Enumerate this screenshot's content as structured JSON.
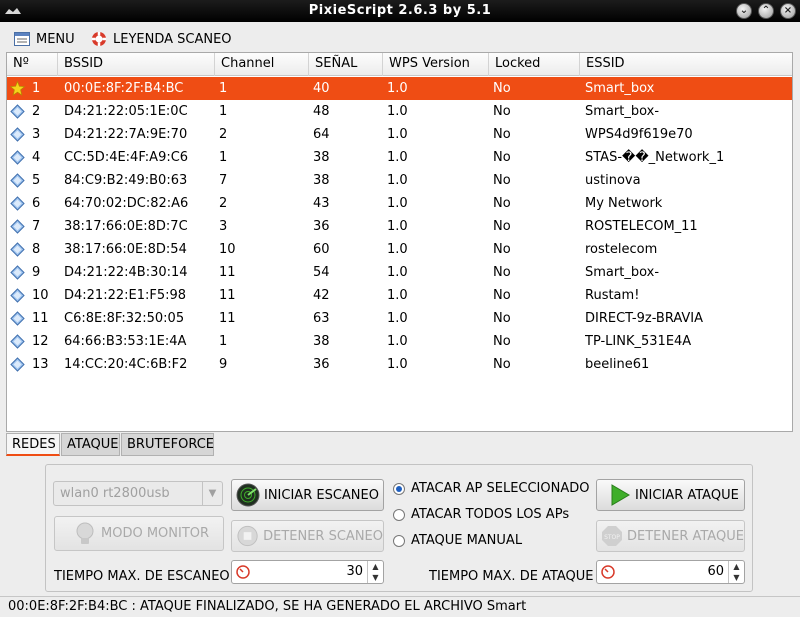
{
  "window": {
    "title": "PixieScript 2.6.3 by 5.1"
  },
  "menubar": {
    "menu_label": "MENU",
    "legend_label": "LEYENDA SCANEO"
  },
  "table": {
    "headers": [
      "Nº",
      "BSSID",
      "Channel",
      "SEÑAL",
      "WPS Version",
      "Locked",
      "ESSID"
    ],
    "rows": [
      {
        "n": "1",
        "bssid": "00:0E:8F:2F:B4:BC",
        "channel": "1",
        "signal": "40",
        "wps": "1.0",
        "locked": "No",
        "essid": "Smart_box",
        "icon": "star-icon",
        "selected": true
      },
      {
        "n": "2",
        "bssid": "D4:21:22:05:1E:0C",
        "channel": "1",
        "signal": "48",
        "wps": "1.0",
        "locked": "No",
        "essid": "Smart_box-",
        "icon": "diamond-icon"
      },
      {
        "n": "3",
        "bssid": "D4:21:22:7A:9E:70",
        "channel": "2",
        "signal": "64",
        "wps": "1.0",
        "locked": "No",
        "essid": "WPS4d9f619e70",
        "icon": "diamond-icon"
      },
      {
        "n": "4",
        "bssid": "CC:5D:4E:4F:A9:C6",
        "channel": "1",
        "signal": "38",
        "wps": "1.0",
        "locked": "No",
        "essid": "STAS-��_Network_1",
        "icon": "diamond-icon"
      },
      {
        "n": "5",
        "bssid": "84:C9:B2:49:B0:63",
        "channel": "7",
        "signal": "38",
        "wps": "1.0",
        "locked": "No",
        "essid": "ustinova",
        "icon": "diamond-icon"
      },
      {
        "n": "6",
        "bssid": "64:70:02:DC:82:A6",
        "channel": "2",
        "signal": "43",
        "wps": "1.0",
        "locked": "No",
        "essid": "My Network",
        "icon": "diamond-icon"
      },
      {
        "n": "7",
        "bssid": "38:17:66:0E:8D:7C",
        "channel": "3",
        "signal": "36",
        "wps": "1.0",
        "locked": "No",
        "essid": "ROSTELECOM_11",
        "icon": "diamond-icon"
      },
      {
        "n": "8",
        "bssid": "38:17:66:0E:8D:54",
        "channel": "10",
        "signal": "60",
        "wps": "1.0",
        "locked": "No",
        "essid": "rostelecom",
        "icon": "diamond-icon"
      },
      {
        "n": "9",
        "bssid": "D4:21:22:4B:30:14",
        "channel": "11",
        "signal": "54",
        "wps": "1.0",
        "locked": "No",
        "essid": "Smart_box-",
        "icon": "diamond-icon"
      },
      {
        "n": "10",
        "bssid": "D4:21:22:E1:F5:98",
        "channel": "11",
        "signal": "42",
        "wps": "1.0",
        "locked": "No",
        "essid": "Rustam!",
        "icon": "diamond-icon"
      },
      {
        "n": "11",
        "bssid": "C6:8E:8F:32:50:05",
        "channel": "11",
        "signal": "63",
        "wps": "1.0",
        "locked": "No",
        "essid": "DIRECT-9z-BRAVIA",
        "icon": "diamond-icon"
      },
      {
        "n": "12",
        "bssid": "64:66:B3:53:1E:4A",
        "channel": "1",
        "signal": "38",
        "wps": "1.0",
        "locked": "No",
        "essid": "TP-LINK_531E4A",
        "icon": "diamond-icon"
      },
      {
        "n": "13",
        "bssid": "14:CC:20:4C:6B:F2",
        "channel": "9",
        "signal": "36",
        "wps": "1.0",
        "locked": "No",
        "essid": "beeline61",
        "icon": "diamond-icon"
      }
    ]
  },
  "tabs": [
    {
      "label": "REDES",
      "active": true
    },
    {
      "label": "ATAQUE",
      "active": false
    },
    {
      "label": "BRUTEFORCE",
      "active": false
    }
  ],
  "controls": {
    "interface_select": "wlan0 rt2800usb",
    "start_scan": "INICIAR ESCANEO",
    "monitor_mode": "MODO MONITOR",
    "stop_scan": "DETENER SCANEO",
    "scan_time_label": "TIEMPO MAX. DE ESCANEO",
    "scan_time_value": "30",
    "radio_selected": "ATACAR AP SELECCIONADO",
    "radio_all": "ATACAR TODOS LOS APs",
    "radio_manual": "ATAQUE MANUAL",
    "start_attack": "INICIAR ATAQUE",
    "stop_attack": "DETENER ATAQUE",
    "attack_time_label": "TIEMPO MAX. DE ATAQUE",
    "attack_time_value": "60"
  },
  "status": {
    "text": "00:0E:8F:2F:B4:BC : ATAQUE FINALIZADO, SE HA GENERADO EL ARCHIVO Smart"
  },
  "colors": {
    "selection": "#ef4d14",
    "accent_blue": "#1f5fbf",
    "play_green": "#3fae2a"
  }
}
